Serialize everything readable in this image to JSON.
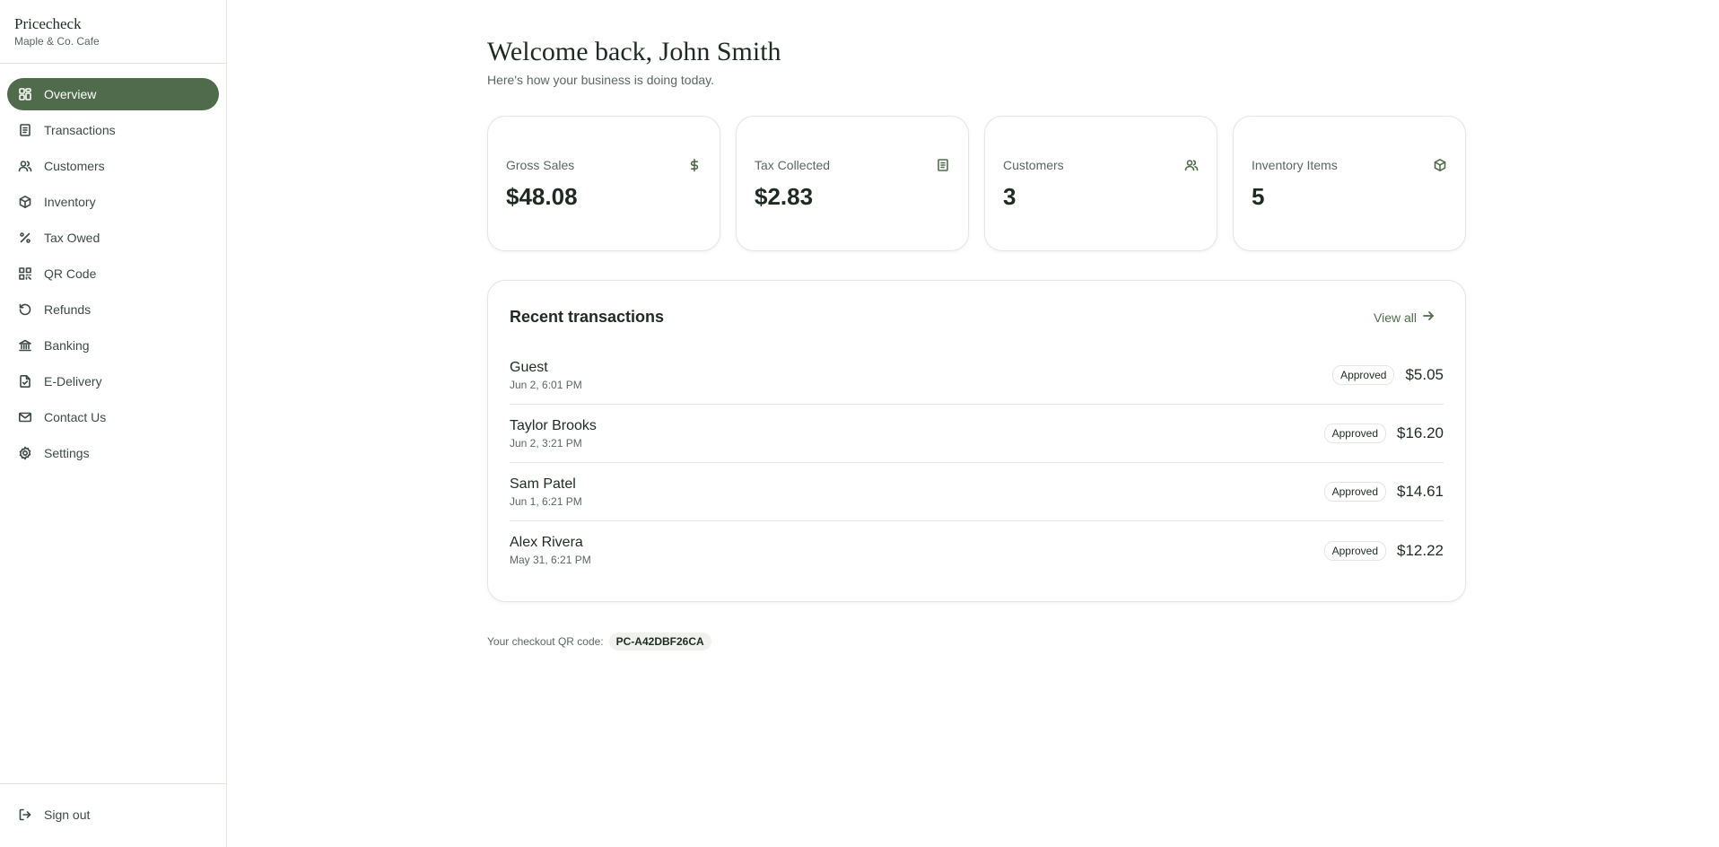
{
  "brand": {
    "name": "Pricecheck",
    "business": "Maple & Co. Cafe"
  },
  "accent_color": "#4f6b4b",
  "sidebar": {
    "items": [
      {
        "label": "Overview",
        "icon": "grid-icon",
        "active": true
      },
      {
        "label": "Transactions",
        "icon": "receipt-icon"
      },
      {
        "label": "Customers",
        "icon": "users-icon"
      },
      {
        "label": "Inventory",
        "icon": "package-icon"
      },
      {
        "label": "Tax Owed",
        "icon": "percent-icon"
      },
      {
        "label": "QR Code",
        "icon": "qr-code-icon"
      },
      {
        "label": "Refunds",
        "icon": "rotate-ccw-icon"
      },
      {
        "label": "Banking",
        "icon": "bank-icon"
      },
      {
        "label": "E-Delivery",
        "icon": "file-check-icon"
      },
      {
        "label": "Contact Us",
        "icon": "mail-icon"
      },
      {
        "label": "Settings",
        "icon": "gear-icon"
      }
    ],
    "signout": "Sign out"
  },
  "header": {
    "title": "Welcome back, John Smith",
    "subtitle": "Here's how your business is doing today."
  },
  "stats": [
    {
      "label": "Gross Sales",
      "value": "$48.08",
      "icon": "dollar-icon"
    },
    {
      "label": "Tax Collected",
      "value": "$2.83",
      "icon": "receipt-icon"
    },
    {
      "label": "Customers",
      "value": "3",
      "icon": "users-icon"
    },
    {
      "label": "Inventory Items",
      "value": "5",
      "icon": "package-icon"
    }
  ],
  "transactions": {
    "title": "Recent transactions",
    "view_all": "View all",
    "rows": [
      {
        "name": "Guest",
        "date": "Jun 2, 6:01 PM",
        "status": "Approved",
        "amount": "$5.05"
      },
      {
        "name": "Taylor Brooks",
        "date": "Jun 2, 3:21 PM",
        "status": "Approved",
        "amount": "$16.20"
      },
      {
        "name": "Sam Patel",
        "date": "Jun 1, 6:21 PM",
        "status": "Approved",
        "amount": "$14.61"
      },
      {
        "name": "Alex Rivera",
        "date": "May 31, 6:21 PM",
        "status": "Approved",
        "amount": "$12.22"
      }
    ]
  },
  "qr": {
    "label": "Your checkout QR code:",
    "code": "PC-A42DBF26CA"
  }
}
